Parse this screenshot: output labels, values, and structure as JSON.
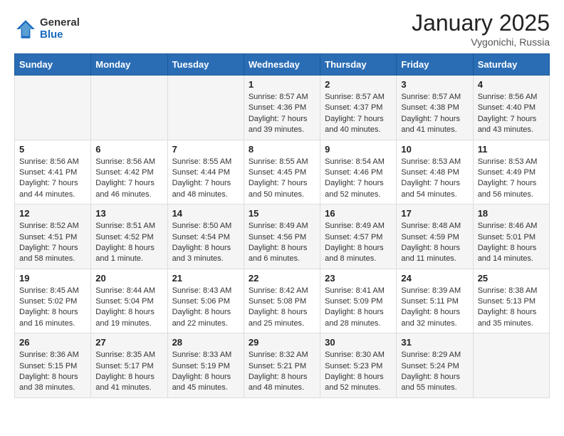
{
  "header": {
    "logo_general": "General",
    "logo_blue": "Blue",
    "month_title": "January 2025",
    "location": "Vygonichi, Russia"
  },
  "days_of_week": [
    "Sunday",
    "Monday",
    "Tuesday",
    "Wednesday",
    "Thursday",
    "Friday",
    "Saturday"
  ],
  "weeks": [
    [
      {
        "day": "",
        "info": ""
      },
      {
        "day": "",
        "info": ""
      },
      {
        "day": "",
        "info": ""
      },
      {
        "day": "1",
        "info": "Sunrise: 8:57 AM\nSunset: 4:36 PM\nDaylight: 7 hours and 39 minutes."
      },
      {
        "day": "2",
        "info": "Sunrise: 8:57 AM\nSunset: 4:37 PM\nDaylight: 7 hours and 40 minutes."
      },
      {
        "day": "3",
        "info": "Sunrise: 8:57 AM\nSunset: 4:38 PM\nDaylight: 7 hours and 41 minutes."
      },
      {
        "day": "4",
        "info": "Sunrise: 8:56 AM\nSunset: 4:40 PM\nDaylight: 7 hours and 43 minutes."
      }
    ],
    [
      {
        "day": "5",
        "info": "Sunrise: 8:56 AM\nSunset: 4:41 PM\nDaylight: 7 hours and 44 minutes."
      },
      {
        "day": "6",
        "info": "Sunrise: 8:56 AM\nSunset: 4:42 PM\nDaylight: 7 hours and 46 minutes."
      },
      {
        "day": "7",
        "info": "Sunrise: 8:55 AM\nSunset: 4:44 PM\nDaylight: 7 hours and 48 minutes."
      },
      {
        "day": "8",
        "info": "Sunrise: 8:55 AM\nSunset: 4:45 PM\nDaylight: 7 hours and 50 minutes."
      },
      {
        "day": "9",
        "info": "Sunrise: 8:54 AM\nSunset: 4:46 PM\nDaylight: 7 hours and 52 minutes."
      },
      {
        "day": "10",
        "info": "Sunrise: 8:53 AM\nSunset: 4:48 PM\nDaylight: 7 hours and 54 minutes."
      },
      {
        "day": "11",
        "info": "Sunrise: 8:53 AM\nSunset: 4:49 PM\nDaylight: 7 hours and 56 minutes."
      }
    ],
    [
      {
        "day": "12",
        "info": "Sunrise: 8:52 AM\nSunset: 4:51 PM\nDaylight: 7 hours and 58 minutes."
      },
      {
        "day": "13",
        "info": "Sunrise: 8:51 AM\nSunset: 4:52 PM\nDaylight: 8 hours and 1 minute."
      },
      {
        "day": "14",
        "info": "Sunrise: 8:50 AM\nSunset: 4:54 PM\nDaylight: 8 hours and 3 minutes."
      },
      {
        "day": "15",
        "info": "Sunrise: 8:49 AM\nSunset: 4:56 PM\nDaylight: 8 hours and 6 minutes."
      },
      {
        "day": "16",
        "info": "Sunrise: 8:49 AM\nSunset: 4:57 PM\nDaylight: 8 hours and 8 minutes."
      },
      {
        "day": "17",
        "info": "Sunrise: 8:48 AM\nSunset: 4:59 PM\nDaylight: 8 hours and 11 minutes."
      },
      {
        "day": "18",
        "info": "Sunrise: 8:46 AM\nSunset: 5:01 PM\nDaylight: 8 hours and 14 minutes."
      }
    ],
    [
      {
        "day": "19",
        "info": "Sunrise: 8:45 AM\nSunset: 5:02 PM\nDaylight: 8 hours and 16 minutes."
      },
      {
        "day": "20",
        "info": "Sunrise: 8:44 AM\nSunset: 5:04 PM\nDaylight: 8 hours and 19 minutes."
      },
      {
        "day": "21",
        "info": "Sunrise: 8:43 AM\nSunset: 5:06 PM\nDaylight: 8 hours and 22 minutes."
      },
      {
        "day": "22",
        "info": "Sunrise: 8:42 AM\nSunset: 5:08 PM\nDaylight: 8 hours and 25 minutes."
      },
      {
        "day": "23",
        "info": "Sunrise: 8:41 AM\nSunset: 5:09 PM\nDaylight: 8 hours and 28 minutes."
      },
      {
        "day": "24",
        "info": "Sunrise: 8:39 AM\nSunset: 5:11 PM\nDaylight: 8 hours and 32 minutes."
      },
      {
        "day": "25",
        "info": "Sunrise: 8:38 AM\nSunset: 5:13 PM\nDaylight: 8 hours and 35 minutes."
      }
    ],
    [
      {
        "day": "26",
        "info": "Sunrise: 8:36 AM\nSunset: 5:15 PM\nDaylight: 8 hours and 38 minutes."
      },
      {
        "day": "27",
        "info": "Sunrise: 8:35 AM\nSunset: 5:17 PM\nDaylight: 8 hours and 41 minutes."
      },
      {
        "day": "28",
        "info": "Sunrise: 8:33 AM\nSunset: 5:19 PM\nDaylight: 8 hours and 45 minutes."
      },
      {
        "day": "29",
        "info": "Sunrise: 8:32 AM\nSunset: 5:21 PM\nDaylight: 8 hours and 48 minutes."
      },
      {
        "day": "30",
        "info": "Sunrise: 8:30 AM\nSunset: 5:23 PM\nDaylight: 8 hours and 52 minutes."
      },
      {
        "day": "31",
        "info": "Sunrise: 8:29 AM\nSunset: 5:24 PM\nDaylight: 8 hours and 55 minutes."
      },
      {
        "day": "",
        "info": ""
      }
    ]
  ]
}
